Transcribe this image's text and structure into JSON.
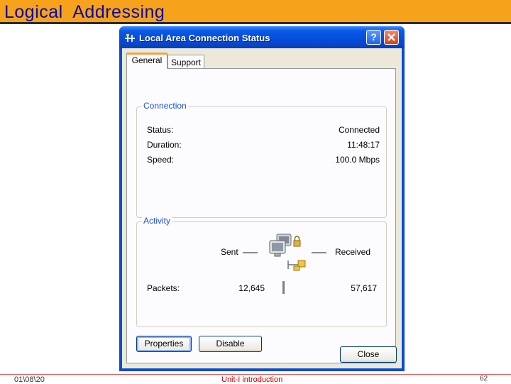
{
  "slide": {
    "title": "Logical  Addressing",
    "footer_date": "01\\08\\20",
    "footer_center": "Unit-I introduction",
    "page_number": "62",
    "accent_color": "#f7a21b",
    "title_color": "#0a0aa0"
  },
  "window": {
    "title": "Local Area Connection Status",
    "title_icon": "network-connection-icon",
    "help_label": "?",
    "tabs": [
      {
        "label": "General",
        "selected": true
      },
      {
        "label": "Support",
        "selected": false
      }
    ],
    "connection": {
      "legend": "Connection",
      "rows": [
        {
          "label": "Status:",
          "value": "Connected"
        },
        {
          "label": "Duration:",
          "value": "11:48:17"
        },
        {
          "label": "Speed:",
          "value": "100.0 Mbps"
        }
      ]
    },
    "activity": {
      "legend": "Activity",
      "sent_label": "Sent",
      "received_label": "Received",
      "packets_label": "Packets:",
      "packets_sent": "12,645",
      "packets_received": "57,617",
      "icon": "network-computers-icon"
    },
    "buttons": {
      "properties": "Properties",
      "disable": "Disable",
      "close": "Close"
    }
  }
}
